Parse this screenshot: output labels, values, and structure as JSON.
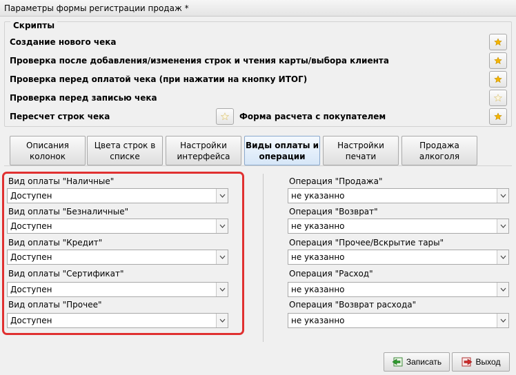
{
  "window": {
    "title": "Параметры формы регистрации продаж *"
  },
  "scripts": {
    "title": "Скрипты",
    "rows": [
      {
        "label": "Создание нового чека",
        "starred": true
      },
      {
        "label": "Проверка после добавления/изменения строк и чтения карты/выбора клиента",
        "starred": true
      },
      {
        "label": "Проверка перед оплатой чека (при нажатии на кнопку ИТОГ)",
        "starred": true
      },
      {
        "label": "Проверка перед записью чека",
        "starred": false
      },
      {
        "label": "Пересчет строк чека",
        "starred": false
      },
      {
        "label": "Форма расчета с покупателем",
        "starred": true
      }
    ],
    "star_filled_color": "#f4b400",
    "star_outline_color": "#d9c37a"
  },
  "tabs": [
    {
      "label_line1": "Описания",
      "label_line2": "колонок",
      "active": false
    },
    {
      "label_line1": "Цвета строк в",
      "label_line2": "списке",
      "active": false
    },
    {
      "label_line1": "Настройки",
      "label_line2": "интерфейса",
      "active": false
    },
    {
      "label_line1": "Виды оплаты и",
      "label_line2": "операции",
      "active": true
    },
    {
      "label_line1": "Настройки",
      "label_line2": "печати",
      "active": false
    },
    {
      "label_line1": "Продажа",
      "label_line2": "алкоголя",
      "active": false
    }
  ],
  "payment_types": [
    {
      "label": "Вид оплаты \"Наличные\"",
      "value": "Доступен"
    },
    {
      "label": "Вид оплаты \"Безналичные\"",
      "value": "Доступен"
    },
    {
      "label": "Вид оплаты \"Кредит\"",
      "value": "Доступен"
    },
    {
      "label": "Вид оплаты \"Сертификат\"",
      "value": "Доступен"
    },
    {
      "label": "Вид оплаты \"Прочее\"",
      "value": "Доступен"
    }
  ],
  "operations": [
    {
      "label": "Операция \"Продажа\"",
      "value": "не указанно"
    },
    {
      "label": "Операция \"Возврат\"",
      "value": "не указанно"
    },
    {
      "label": "Операция \"Прочее/Вскрытие тары\"",
      "value": "не указанно"
    },
    {
      "label": "Операция \"Расход\"",
      "value": "не указанно"
    },
    {
      "label": "Операция \"Возврат расхода\"",
      "value": "не указанно"
    }
  ],
  "buttons": {
    "save": "Записать",
    "exit": "Выход"
  },
  "highlight_color": "#e03030"
}
